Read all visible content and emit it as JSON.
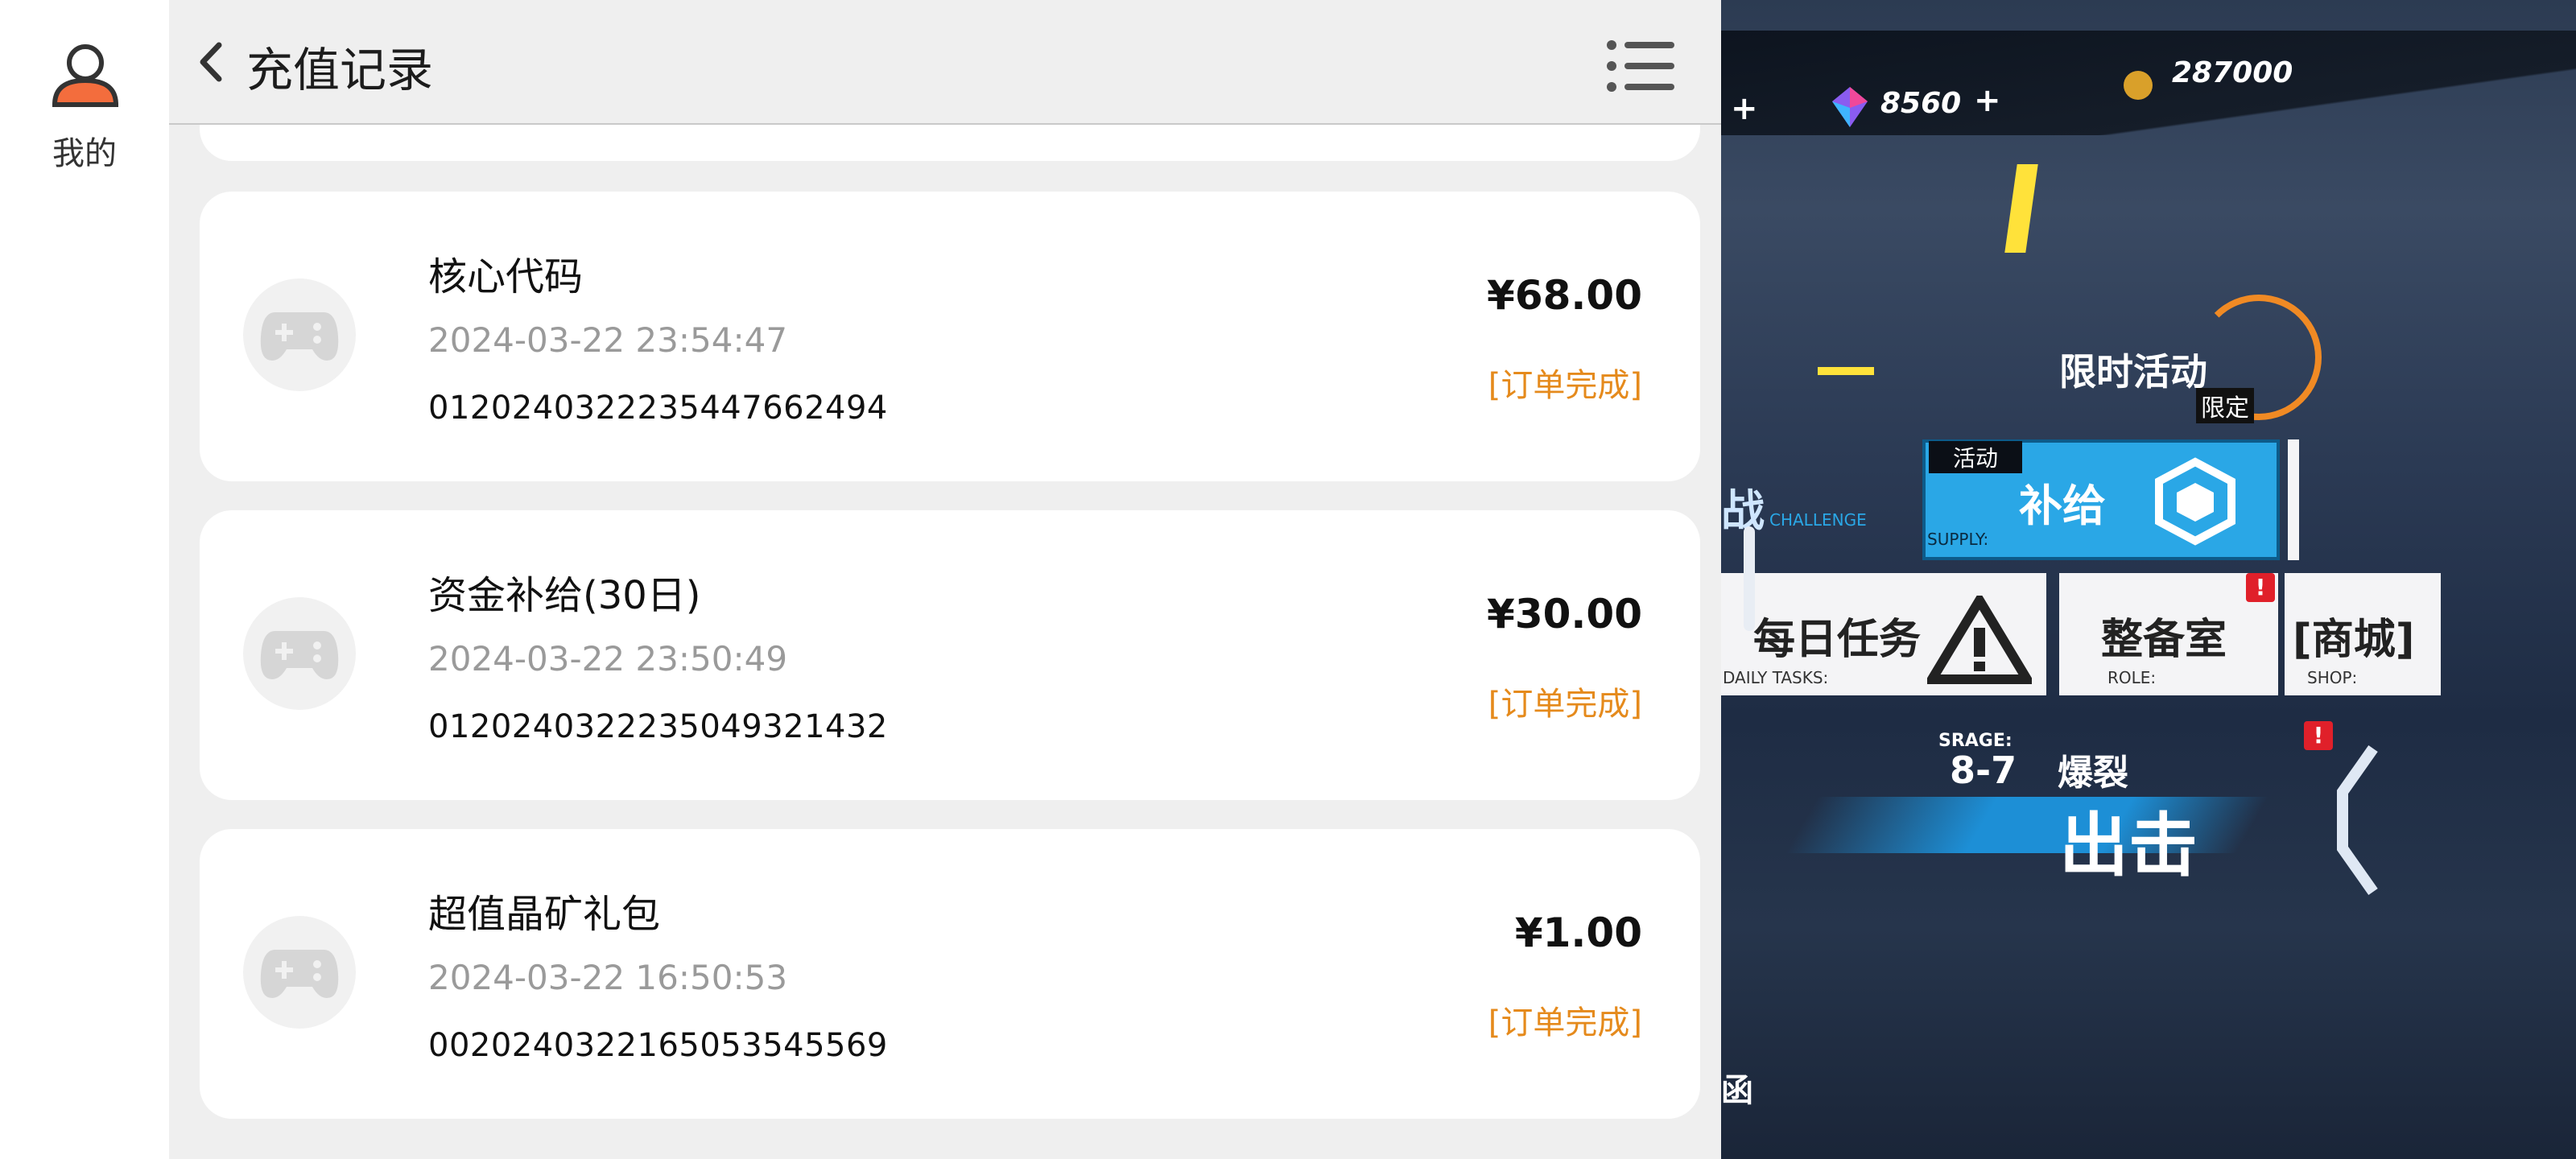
{
  "sidebar": {
    "mine_label": "我的"
  },
  "header": {
    "title": "充值记录"
  },
  "records": [
    {
      "name": "核心代码",
      "time": "2024-03-22 23:54:47",
      "order_no": "0120240322235447662494",
      "amount": "¥68.00",
      "status": "[订单完成]"
    },
    {
      "name": "资金补给(30日)",
      "time": "2024-03-22 23:50:49",
      "order_no": "0120240322235049321432",
      "amount": "¥30.00",
      "status": "[订单完成]"
    },
    {
      "name": "超值晶矿礼包",
      "time": "2024-03-22 16:50:53",
      "order_no": "0020240322165053545569",
      "amount": "¥1.00",
      "status": "[订单完成]"
    }
  ],
  "colors": {
    "status": "#e58a1c",
    "card_bg": "#ffffff",
    "panel_bg": "#efefef",
    "supply_blue": "#2aa7e6"
  },
  "game": {
    "gems": "8560",
    "coins": "287000",
    "limited_event": "限时活动",
    "limited_tag": "限定",
    "event_tag": "活动",
    "supply": "补给",
    "supply_en": "SUPPLY:",
    "challenge_partial": "战",
    "challenge_en": "CHALLENGE",
    "daily": "每日任务",
    "daily_en": "DAILY TASKS:",
    "armory": "整备室",
    "armory_en": "ROLE:",
    "shop": "[商城]",
    "shop_en": "SHOP:",
    "stage_label": "SRAGE:",
    "stage_code": "8-7",
    "stage_name": "爆裂",
    "sortie": "出击",
    "bottom_partial": "函"
  }
}
